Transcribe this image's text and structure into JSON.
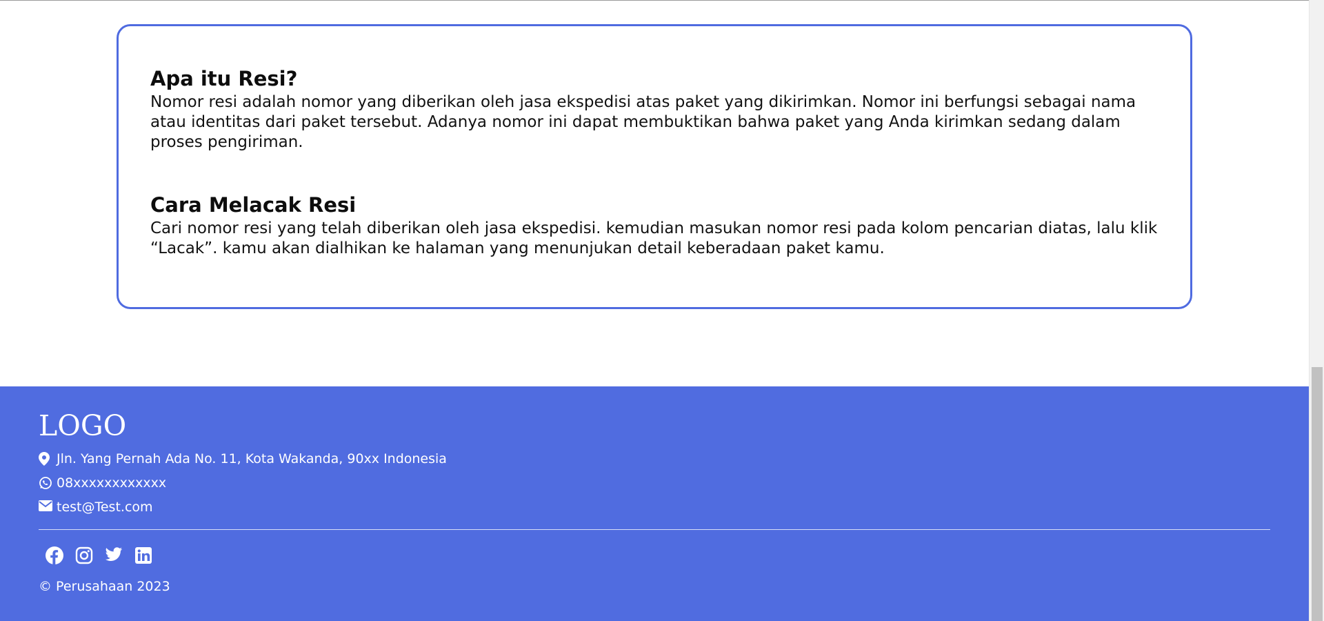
{
  "info": {
    "sections": [
      {
        "title": "Apa itu Resi?",
        "body": "Nomor resi adalah nomor yang diberikan oleh jasa ekspedisi atas paket yang dikirimkan. Nomor ini berfungsi sebagai nama atau identitas dari paket tersebut. Adanya nomor ini dapat membuktikan bahwa paket yang Anda kirimkan sedang dalam proses pengiriman."
      },
      {
        "title": "Cara Melacak Resi",
        "body": "Cari nomor resi yang telah diberikan oleh jasa ekspedisi. kemudian masukan nomor resi pada kolom pencarian diatas, lalu klik “Lacak”. kamu akan dialhikan ke halaman yang menunjukan detail keberadaan paket kamu."
      }
    ]
  },
  "footer": {
    "logo": "LOGO",
    "address": "Jln. Yang Pernah Ada No. 11, Kota Wakanda, 90xx Indonesia",
    "phone": "08xxxxxxxxxxxx",
    "email": "test@Test.com",
    "socials": [
      "facebook-icon",
      "instagram-icon",
      "twitter-icon",
      "linkedin-icon"
    ],
    "copyright": "© Perusahaan 2023"
  },
  "colors": {
    "accent": "#506ce0",
    "card_border": "#4f6be0"
  }
}
